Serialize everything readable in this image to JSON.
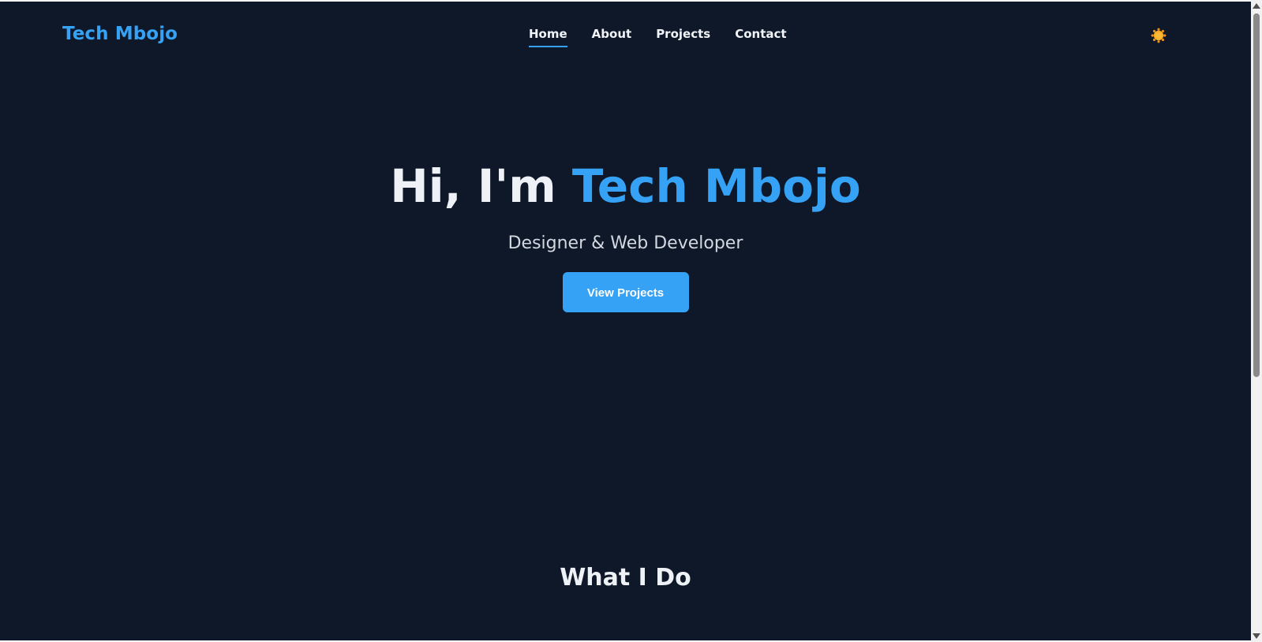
{
  "brand": {
    "name": "Tech Mbojo"
  },
  "nav": {
    "items": [
      {
        "label": "Home",
        "active": true
      },
      {
        "label": "About",
        "active": false
      },
      {
        "label": "Projects",
        "active": false
      },
      {
        "label": "Contact",
        "active": false
      }
    ],
    "theme_toggle_icon": "sun-icon"
  },
  "hero": {
    "greeting": "Hi, I'm",
    "name": "Tech Mbojo",
    "subtitle": "Designer & Web Developer",
    "cta_label": "View Projects"
  },
  "services": {
    "title": "What I Do"
  },
  "colors": {
    "background": "#0f1828",
    "accent": "#35a2f5",
    "text": "#eef1f5",
    "sun": "#f5a623"
  }
}
